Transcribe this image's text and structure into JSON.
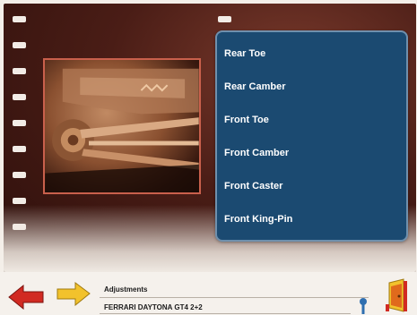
{
  "menu": {
    "items": [
      {
        "label": "Rear Toe"
      },
      {
        "label": "Rear Camber"
      },
      {
        "label": "Front Toe"
      },
      {
        "label": "Front Camber"
      },
      {
        "label": "Front Caster"
      },
      {
        "label": "Front King-Pin"
      }
    ]
  },
  "footer": {
    "section": "Adjustments",
    "vehicle": "FERRARI DAYTONA GT4 2+2"
  },
  "icons": {
    "back": "arrow-left-icon",
    "forward": "arrow-right-icon",
    "info": "info-icon",
    "exit": "exit-door-icon"
  },
  "colors": {
    "menu_bg": "#1b4a71",
    "menu_border": "#6f90ad",
    "film_bg": "#4a1d16",
    "back_arrow": "#d12a22",
    "forward_arrow": "#f2c22c"
  }
}
